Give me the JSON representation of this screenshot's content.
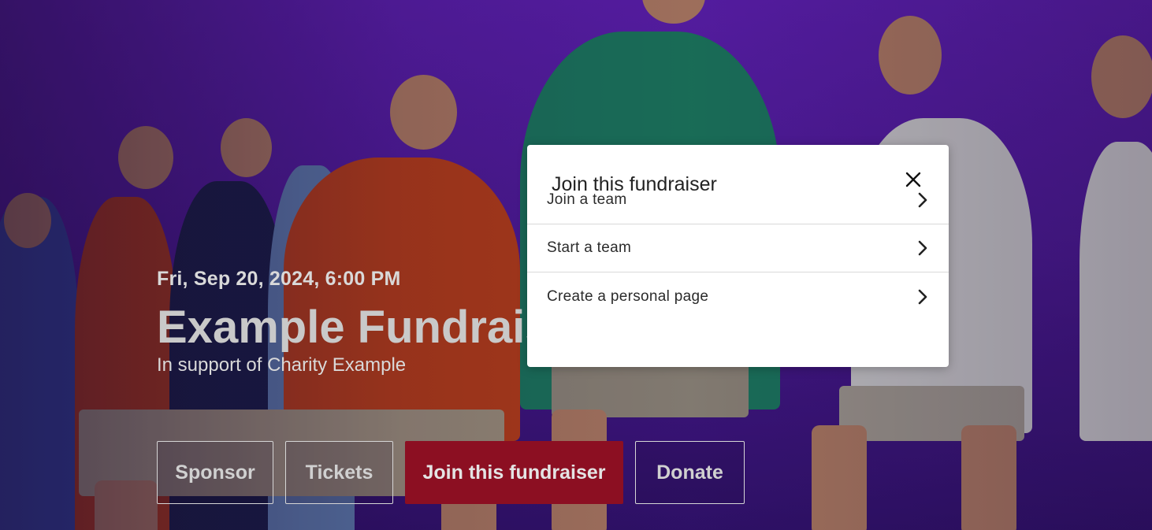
{
  "hero": {
    "date": "Fri, Sep 20, 2024, 6:00 PM",
    "title": "Example Fundraiser",
    "subtitle": "In support of Charity Example",
    "background_color": "#5a1fb0"
  },
  "actions": {
    "sponsor_label": "Sponsor",
    "tickets_label": "Tickets",
    "join_label": "Join this fundraiser",
    "donate_label": "Donate",
    "join_color": "#8c0f22"
  },
  "modal": {
    "title": "Join this fundraiser",
    "close_icon": "close-icon",
    "options": [
      {
        "label": "Join a team",
        "icon": "chevron-right-icon"
      },
      {
        "label": "Start a team",
        "icon": "chevron-right-icon"
      },
      {
        "label": "Create a personal page",
        "icon": "chevron-right-icon"
      }
    ]
  }
}
